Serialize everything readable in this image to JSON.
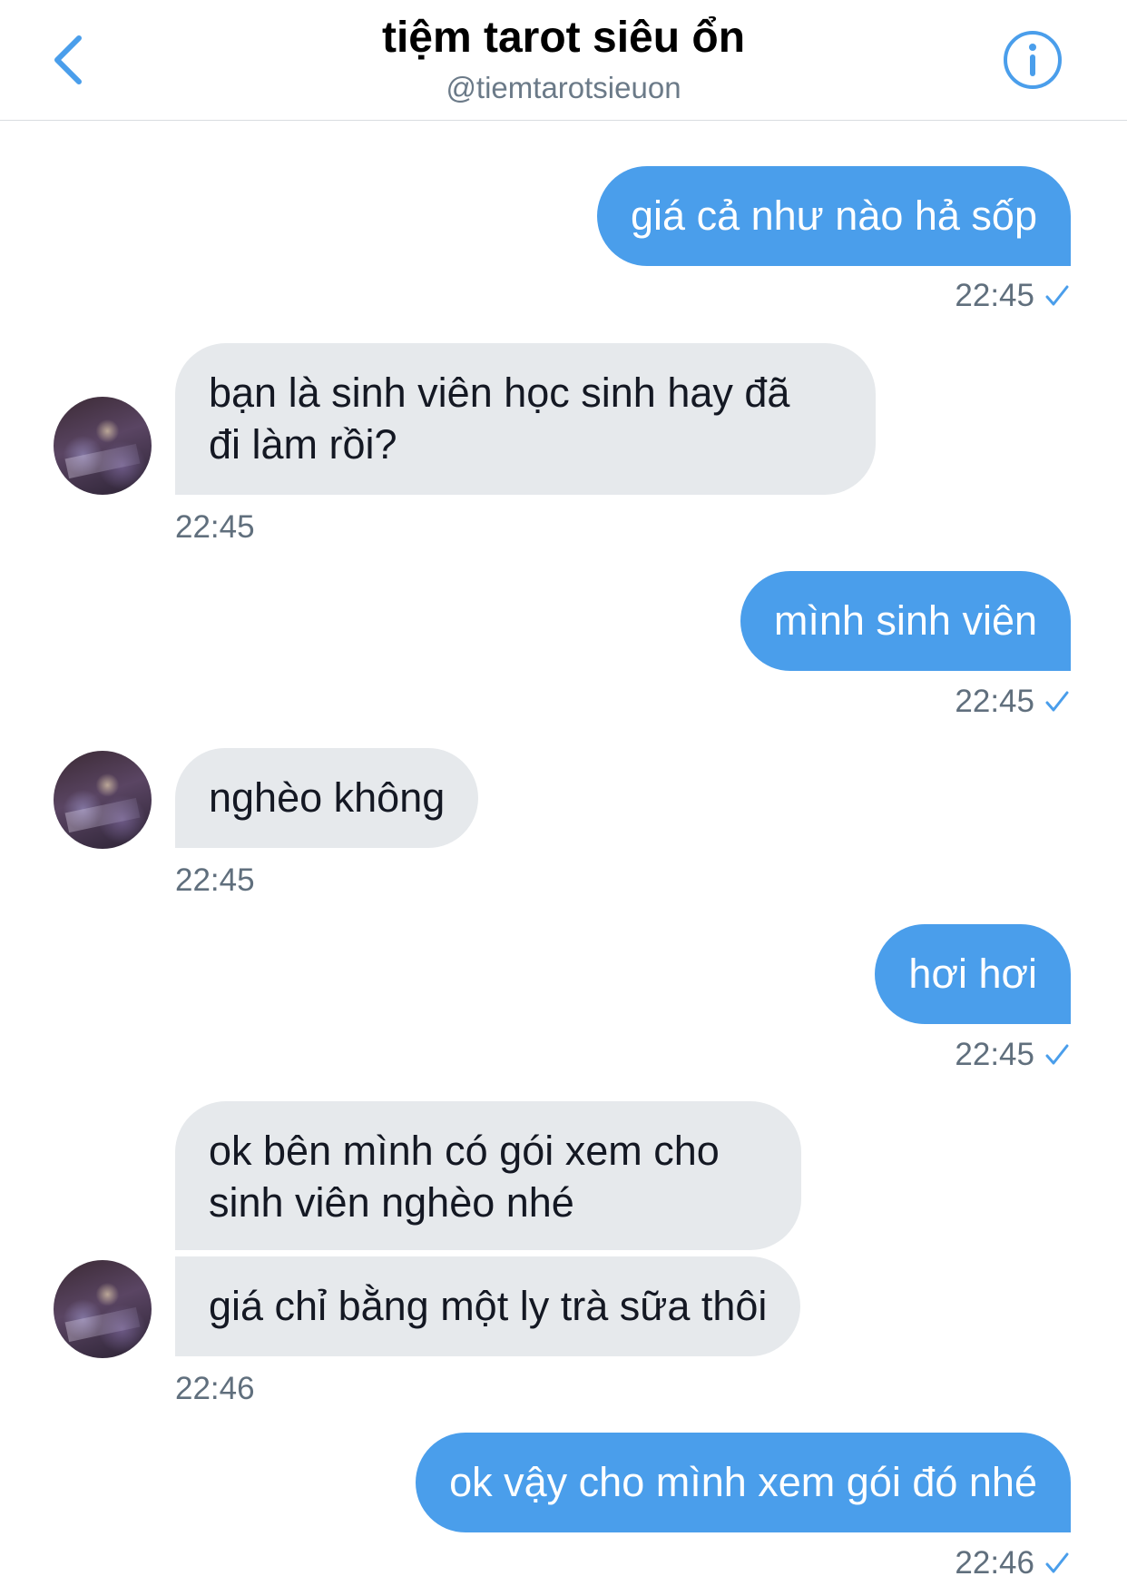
{
  "header": {
    "title": "tiệm tarot siêu ổn",
    "handle": "@tiemtarotsieuon",
    "back_icon": "chevron-left-icon",
    "info_icon": "info-icon"
  },
  "colors": {
    "accent": "#4a9eeb",
    "incoming_bubble": "#e6e9ec",
    "timestamp": "#606f7d"
  },
  "messages": [
    {
      "direction": "outgoing",
      "text": "giá cả như nào hả sốp",
      "time": "22:45",
      "read": true
    },
    {
      "direction": "incoming",
      "lines": [
        "bạn là sinh viên học sinh hay đã",
        "đi làm rồi?"
      ],
      "time": "22:45"
    },
    {
      "direction": "outgoing",
      "text": "mình sinh viên",
      "time": "22:45",
      "read": true
    },
    {
      "direction": "incoming",
      "lines": [
        "nghèo không"
      ],
      "time": "22:45"
    },
    {
      "direction": "outgoing",
      "text": "hơi hơi",
      "time": "22:45",
      "read": true
    },
    {
      "direction": "incoming",
      "lines": [
        "ok bên mình có gói xem cho",
        "sinh viên nghèo nhé"
      ]
    },
    {
      "direction": "incoming",
      "lines": [
        "giá chỉ bằng một ly trà sữa thôi"
      ],
      "time": "22:46"
    },
    {
      "direction": "outgoing",
      "text": "ok vậy cho mình xem gói đó nhé",
      "time": "22:46",
      "read": true
    }
  ]
}
